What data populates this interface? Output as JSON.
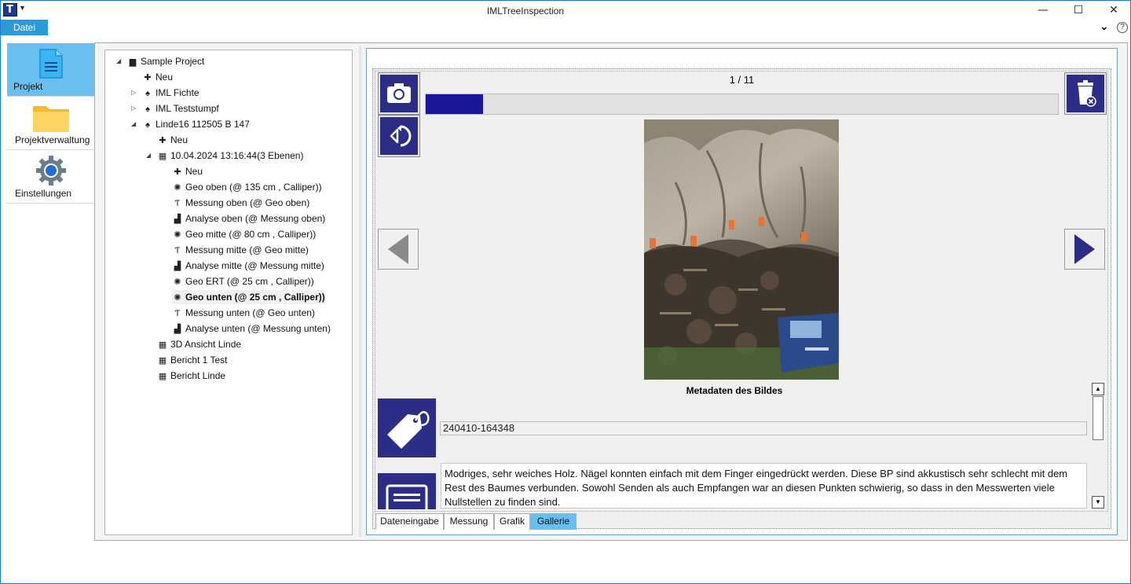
{
  "window": {
    "title": "IMLTreeInspection",
    "app_icon_letter": "T",
    "controls": {
      "minimize": "—",
      "maximize": "☐",
      "close": "✕"
    }
  },
  "menu": {
    "file_label": "Datei",
    "help_label": "?"
  },
  "nav": {
    "items": [
      {
        "label": "Projekt",
        "icon": "document-icon",
        "active": true
      },
      {
        "label": "Projektverwaltung",
        "icon": "folder-icon",
        "active": false
      },
      {
        "label": "Einstellungen",
        "icon": "gear-icon",
        "active": false
      }
    ]
  },
  "tree": {
    "items": [
      {
        "label": "Sample Project",
        "icon": "folder-icon",
        "expander": "expanded",
        "level": 0
      },
      {
        "label": "Neu",
        "icon": "plus-icon",
        "expander": "",
        "level": 1
      },
      {
        "label": "IML Fichte",
        "icon": "tree-icon",
        "expander": "collapsed",
        "level": 1
      },
      {
        "label": "IML Teststumpf",
        "icon": "tree-icon",
        "expander": "collapsed",
        "level": 1
      },
      {
        "label": "Linde16 112505 B 147",
        "icon": "tree-icon",
        "expander": "expanded",
        "level": 1
      },
      {
        "label": "Neu",
        "icon": "plus-icon",
        "expander": "",
        "level": 2
      },
      {
        "label": "10.04.2024 13:16:44(3 Ebenen)",
        "icon": "grid-icon",
        "expander": "expanded",
        "level": 2
      },
      {
        "label": "Neu",
        "icon": "plus-icon",
        "expander": "",
        "level": 3
      },
      {
        "label": "Geo oben (@ 135 cm , Calliper))",
        "icon": "geometry-icon",
        "expander": "",
        "level": 3
      },
      {
        "label": "Messung oben (@ Geo oben)",
        "icon": "measure-icon",
        "expander": "",
        "level": 3
      },
      {
        "label": "Analyse oben (@ Messung oben)",
        "icon": "chart-icon",
        "expander": "",
        "level": 3
      },
      {
        "label": "Geo mitte (@ 80 cm , Calliper))",
        "icon": "geometry-icon",
        "expander": "",
        "level": 3
      },
      {
        "label": "Messung mitte (@ Geo mitte)",
        "icon": "measure-icon",
        "expander": "",
        "level": 3
      },
      {
        "label": "Analyse mitte (@ Messung mitte)",
        "icon": "chart-icon",
        "expander": "",
        "level": 3
      },
      {
        "label": "Geo ERT (@ 25 cm , Calliper))",
        "icon": "geometry-icon",
        "expander": "",
        "level": 3
      },
      {
        "label": "Geo unten (@ 25 cm , Calliper))",
        "icon": "geometry-icon",
        "expander": "",
        "level": 3,
        "selected": true
      },
      {
        "label": "Messung unten (@ Geo unten)",
        "icon": "measure-icon",
        "expander": "",
        "level": 3
      },
      {
        "label": "Analyse unten (@ Messung unten)",
        "icon": "chart-icon",
        "expander": "",
        "level": 3
      },
      {
        "label": "3D Ansicht Linde",
        "icon": "grid-icon",
        "expander": "",
        "level": 2
      },
      {
        "label": "Bericht 1 Test",
        "icon": "grid-icon",
        "expander": "",
        "level": 2
      },
      {
        "label": "Bericht Linde",
        "icon": "grid-icon",
        "expander": "",
        "level": 2
      }
    ]
  },
  "gallery": {
    "counter": "1 / 11",
    "progress": 0.091,
    "metadata_title": "Metadaten des Bildes",
    "image_name": "240410-164348",
    "description": "Modriges, sehr weiches Holz. Nägel konnten einfach mit dem Finger eingedrückt werden. Diese BP sind akkustisch sehr schlecht mit dem Rest des Baumes verbunden. Sowohl Senden als auch Empfangen war an diesen Punkten schwierig, so dass in den Messwerten viele Nullstellen zu finden sind.",
    "colors": {
      "button": "#2b2d86",
      "progress": "#1a1898",
      "accent": "#68bff0"
    }
  },
  "tabs": [
    {
      "label": "Dateneingabe",
      "active": false
    },
    {
      "label": "Messung",
      "active": false
    },
    {
      "label": "Grafik",
      "active": false
    },
    {
      "label": "Gallerie",
      "active": true
    }
  ]
}
